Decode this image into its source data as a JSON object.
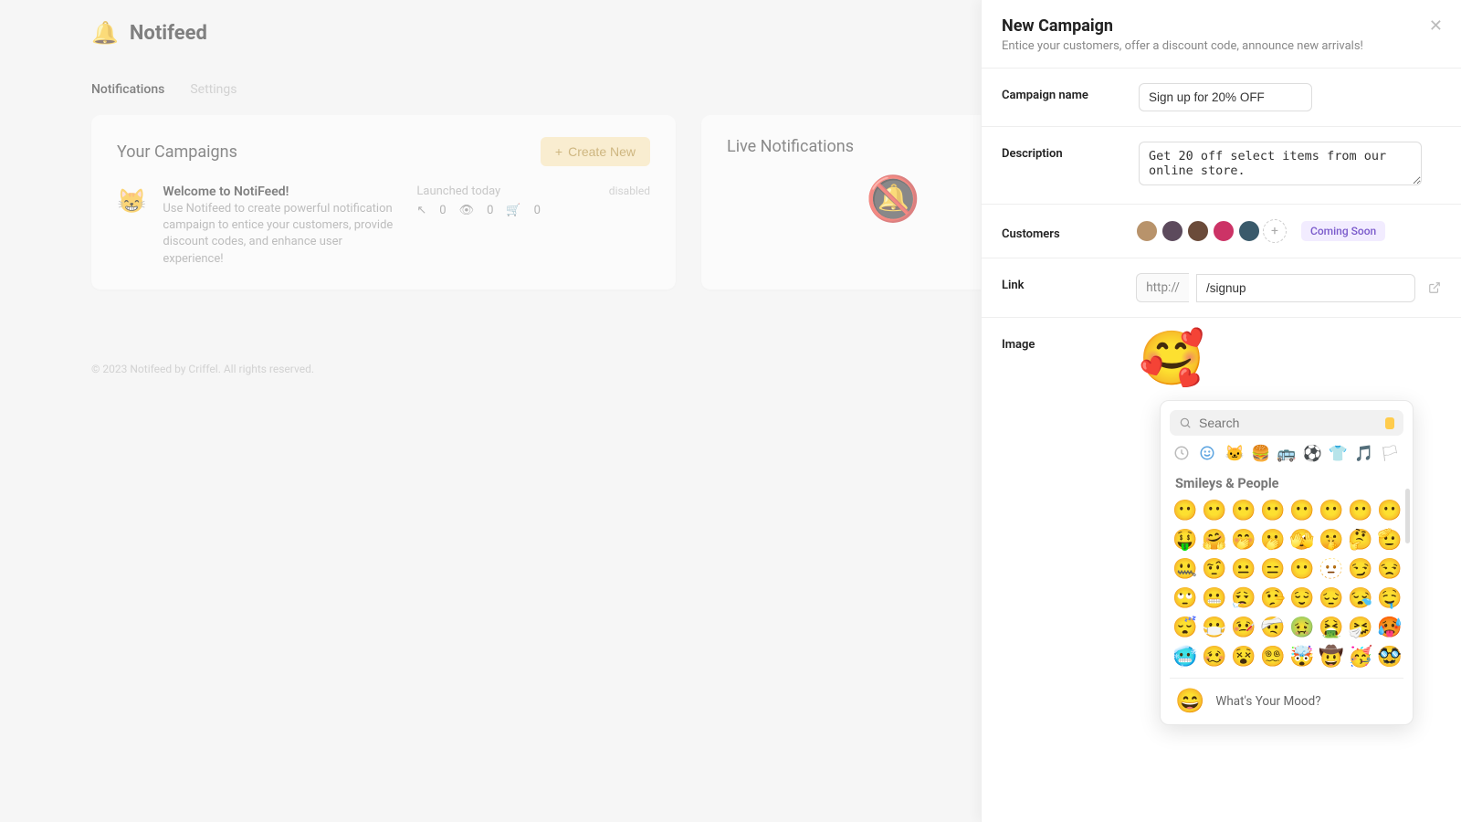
{
  "brand": {
    "name": "Notifeed",
    "bell_glyph": "🔔"
  },
  "tabs": {
    "notifications": "Notifications",
    "settings": "Settings"
  },
  "campaigns": {
    "title": "Your Campaigns",
    "create_label": "Create New",
    "item": {
      "emoji": "😸",
      "title": "Welcome to NotiFeed!",
      "body": "Use Notifeed to create powerful notification campaign to entice your customers, provide discount codes, and enhance user experience!",
      "launched": "Launched today",
      "clicks": "0",
      "views": "0",
      "carts": "0",
      "status": "disabled"
    }
  },
  "live": {
    "title": "Live Notifications"
  },
  "footer": "© 2023 Notifeed by Criffel. All rights reserved.",
  "panel": {
    "title": "New Campaign",
    "subtitle": "Entice your customers, offer a discount code, announce new arrivals!",
    "fields": {
      "name_label": "Campaign name",
      "name_value": "Sign up for 20% OFF",
      "desc_label": "Description",
      "desc_value": "Get 20 off select items from our online store.",
      "customers_label": "Customers",
      "soon": "Coming Soon",
      "link_label": "Link",
      "link_prefix": "http://",
      "link_value": "/signup",
      "image_label": "Image",
      "image_emoji": "🥰"
    }
  },
  "picker": {
    "search_placeholder": "Search",
    "section": "Smileys & People",
    "grid": [
      "😶",
      "😶",
      "😶",
      "😶",
      "😶",
      "😶",
      "😶",
      "😶",
      "🤑",
      "🤗",
      "🤭",
      "🫢",
      "🫣",
      "🤫",
      "🤔",
      "🫡",
      "🤐",
      "🤨",
      "😐",
      "😑",
      "😶",
      "🫥",
      "😏",
      "😒",
      "🙄",
      "😬",
      "😮‍💨",
      "🤥",
      "😌",
      "😔",
      "😪",
      "🤤",
      "😴",
      "😷",
      "🤒",
      "🤕",
      "🤢",
      "🤮",
      "🤧",
      "🥵",
      "🥶",
      "🥴",
      "😵",
      "😵‍💫",
      "🤯",
      "🤠",
      "🥳",
      "🥸"
    ],
    "mood_emoji": "😄",
    "mood_text": "What's Your Mood?"
  }
}
